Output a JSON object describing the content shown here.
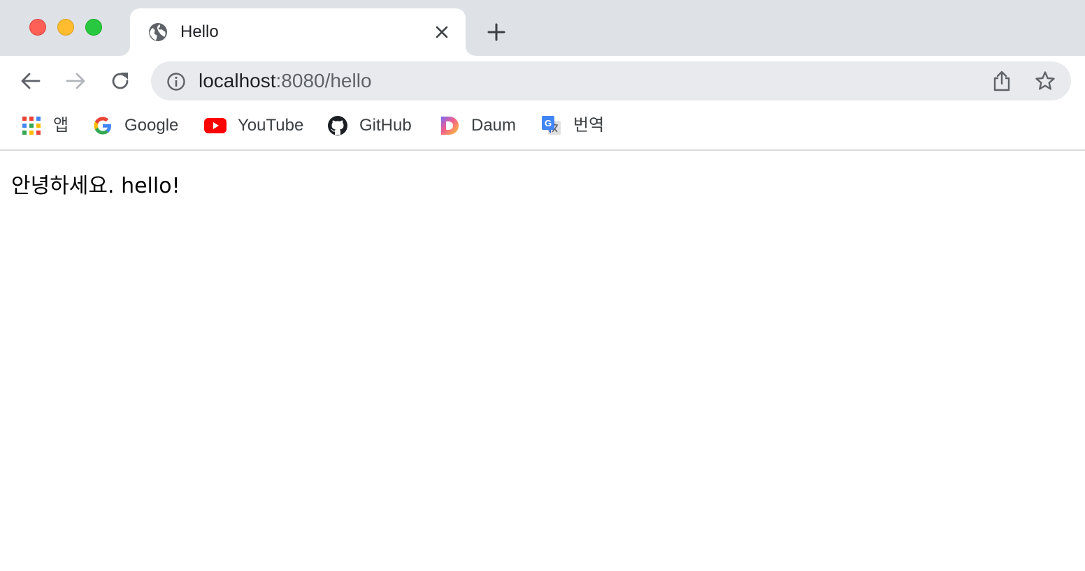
{
  "tab": {
    "title": "Hello"
  },
  "address_bar": {
    "host": "localhost",
    "rest": ":8080/hello"
  },
  "bookmarks": [
    {
      "label": "앱",
      "icon": "apps-grid-icon"
    },
    {
      "label": "Google",
      "icon": "google-icon"
    },
    {
      "label": "YouTube",
      "icon": "youtube-icon"
    },
    {
      "label": "GitHub",
      "icon": "github-icon"
    },
    {
      "label": "Daum",
      "icon": "daum-icon"
    },
    {
      "label": "번역",
      "icon": "translate-icon"
    }
  ],
  "page": {
    "text": "안녕하세요. hello!"
  },
  "colors": {
    "tabstrip_bg": "#dee1e6",
    "omnibox_bg": "#e8eaed",
    "traffic_close": "#fe5f57",
    "traffic_minimize": "#febc2e",
    "traffic_maximize": "#28c840"
  }
}
